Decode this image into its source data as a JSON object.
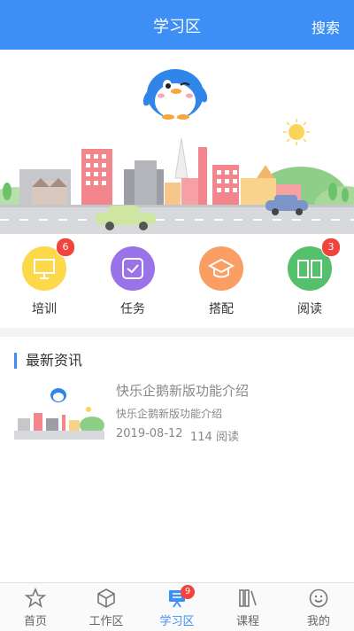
{
  "header": {
    "title": "学习区",
    "search_label": "搜索"
  },
  "shortcuts": [
    {
      "label": "培训",
      "badge": "6",
      "icon": "presentation-board-icon",
      "color": "#fdd84a"
    },
    {
      "label": "任务",
      "badge": "",
      "icon": "checkmark-task-icon",
      "color": "#9b73e8"
    },
    {
      "label": "搭配",
      "badge": "",
      "icon": "graduation-cap-icon",
      "color": "#fb9e64"
    },
    {
      "label": "阅读",
      "badge": "3",
      "icon": "open-book-icon",
      "color": "#54c06b"
    }
  ],
  "news": {
    "heading": "最新资讯",
    "items": [
      {
        "title": "快乐企鹅新版功能介绍",
        "desc": "快乐企鹅新版功能介绍",
        "date": "2019-08-12",
        "reads": "114 阅读"
      }
    ]
  },
  "tabbar": [
    {
      "label": "首页",
      "icon": "star-icon"
    },
    {
      "label": "工作区",
      "icon": "cube-icon"
    },
    {
      "label": "学习区",
      "icon": "presentation-icon",
      "badge": "9",
      "active": true
    },
    {
      "label": "课程",
      "icon": "books-icon"
    },
    {
      "label": "我的",
      "icon": "smiley-face-icon"
    }
  ],
  "colors": {
    "accent": "#3d8ff5",
    "badge": "#f0443c"
  }
}
